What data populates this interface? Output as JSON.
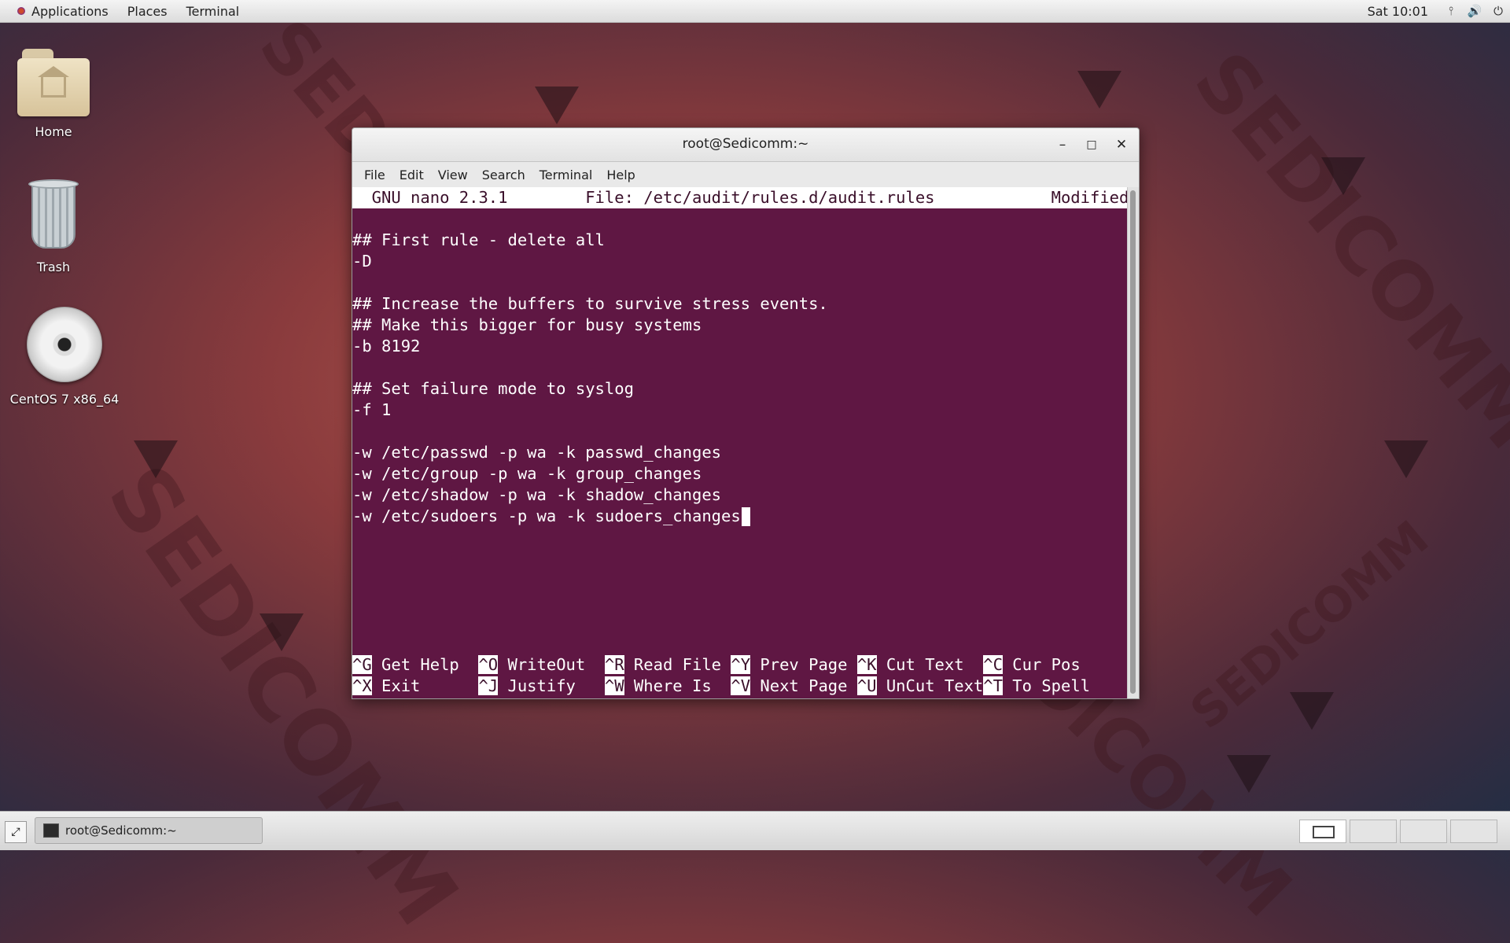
{
  "top_panel": {
    "applications": "Applications",
    "places": "Places",
    "terminal": "Terminal",
    "clock": "Sat 10:01",
    "tray_icons": [
      "network-icon",
      "volume-icon",
      "power-icon"
    ]
  },
  "desktop": {
    "icons": [
      {
        "label": "Home",
        "icon": "home-folder-icon"
      },
      {
        "label": "Trash",
        "icon": "trash-icon"
      },
      {
        "label": "CentOS 7 x86_64",
        "icon": "disc-icon"
      }
    ],
    "wallpaper_text": "SEDICOMM"
  },
  "window": {
    "title": "root@Sedicomm:~",
    "controls": [
      "minimize",
      "maximize",
      "close"
    ],
    "menu": [
      "File",
      "Edit",
      "View",
      "Search",
      "Terminal",
      "Help"
    ]
  },
  "nano": {
    "header": "  GNU nano 2.3.1        File: /etc/audit/rules.d/audit.rules            Modified  ",
    "lines": [
      "",
      "## First rule - delete all",
      "-D",
      "",
      "## Increase the buffers to survive stress events.",
      "## Make this bigger for busy systems",
      "-b 8192",
      "",
      "## Set failure mode to syslog",
      "-f 1",
      "",
      "-w /etc/passwd -p wa -k passwd_changes",
      "-w /etc/group -p wa -k group_changes",
      "-w /etc/shadow -p wa -k shadow_changes",
      "-w /etc/sudoers -p wa -k sudoers_changes"
    ],
    "shortcuts_row1": [
      {
        "key": "^G",
        "label": " Get Help  "
      },
      {
        "key": "^O",
        "label": " WriteOut  "
      },
      {
        "key": "^R",
        "label": " Read File "
      },
      {
        "key": "^Y",
        "label": " Prev Page "
      },
      {
        "key": "^K",
        "label": " Cut Text  "
      },
      {
        "key": "^C",
        "label": " Cur Pos"
      }
    ],
    "shortcuts_row2": [
      {
        "key": "^X",
        "label": " Exit      "
      },
      {
        "key": "^J",
        "label": " Justify   "
      },
      {
        "key": "^W",
        "label": " Where Is  "
      },
      {
        "key": "^V",
        "label": " Next Page "
      },
      {
        "key": "^U",
        "label": " UnCut Text"
      },
      {
        "key": "^T",
        "label": " To Spell"
      }
    ]
  },
  "taskbar": {
    "task_label": "root@Sedicomm:~",
    "workspaces": 4,
    "active_workspace": 1
  }
}
